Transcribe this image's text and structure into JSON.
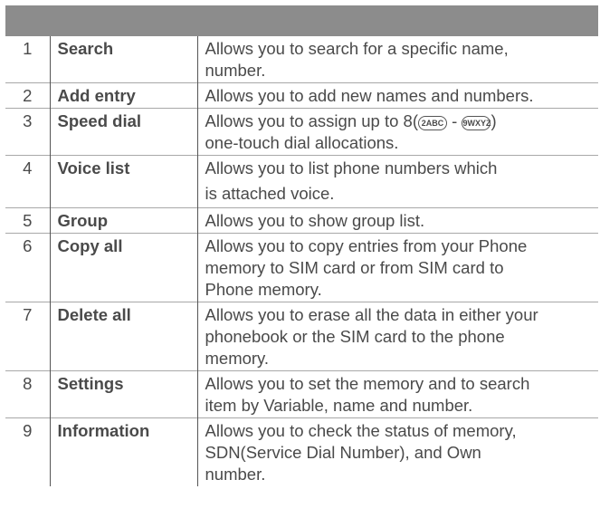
{
  "rows": [
    {
      "num": "1",
      "name": "Search",
      "desc": "Allows you to search for a specific name,\nnumber."
    },
    {
      "num": "2",
      "name": "Add entry",
      "desc": "Allows you to add new names and numbers."
    },
    {
      "num": "3",
      "name": "Speed dial",
      "desc_start": "Allows you to assign up to 8(",
      "key_from": "2ABC",
      "desc_mid": " - ",
      "key_to": "9WXYZ",
      "desc_end": ")\none-touch dial allocations."
    },
    {
      "num": "4",
      "name": "Voice list",
      "desc": "Allows you to list phone numbers which\nis attached voice."
    },
    {
      "num": "5",
      "name": "Group",
      "desc": "Allows you to show group list."
    },
    {
      "num": "6",
      "name": "Copy all",
      "desc": "Allows you to copy entries from your Phone\nmemory to SIM card or from SIM card to\nPhone memory."
    },
    {
      "num": "7",
      "name": "Delete all",
      "desc": "Allows you to erase all the data in either your\nphonebook or the SIM card to the phone\nmemory."
    },
    {
      "num": "8",
      "name": "Settings",
      "desc": "Allows you to set the memory and to search\nitem by Variable, name and number."
    },
    {
      "num": "9",
      "name": "Information",
      "desc": "Allows you to check the status of memory,\nSDN(Service Dial Number), and Own\nnumber."
    }
  ],
  "colors": {
    "header_bar": "#8c8c8c",
    "text": "#4a4a4a"
  },
  "icons": {
    "key_from": "key-2-icon",
    "key_to": "key-9-icon"
  }
}
